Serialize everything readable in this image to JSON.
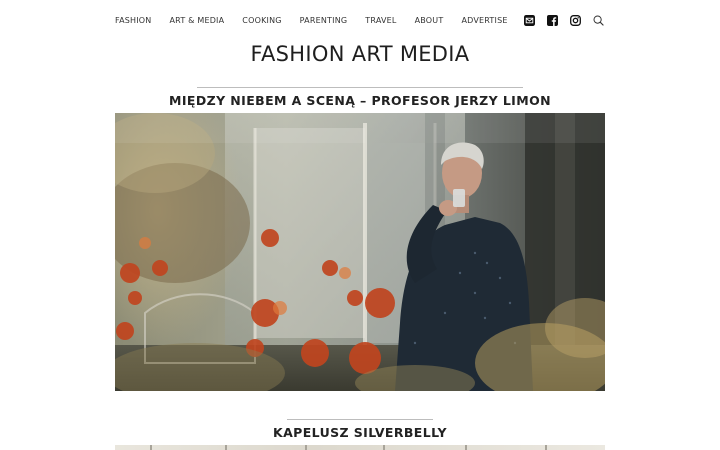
{
  "nav": {
    "items": [
      {
        "label": "FASHION"
      },
      {
        "label": "ART & MEDIA"
      },
      {
        "label": "COOKING"
      },
      {
        "label": "PARENTING"
      },
      {
        "label": "TRAVEL"
      },
      {
        "label": "ABOUT"
      },
      {
        "label": "ADVERTISE"
      }
    ],
    "icons": [
      "email-icon",
      "facebook-icon",
      "instagram-icon",
      "search-icon"
    ]
  },
  "site": {
    "title": "FASHION ART MEDIA"
  },
  "articles": [
    {
      "title": "MIĘDZY NIEBEM A SCENĄ – PROFESOR JERZY LIMON"
    },
    {
      "title": "KAPELUSZ SILVERBELLY"
    }
  ],
  "colors": {
    "text": "#222222",
    "rule": "#bdbdbd",
    "background": "#ffffff"
  }
}
